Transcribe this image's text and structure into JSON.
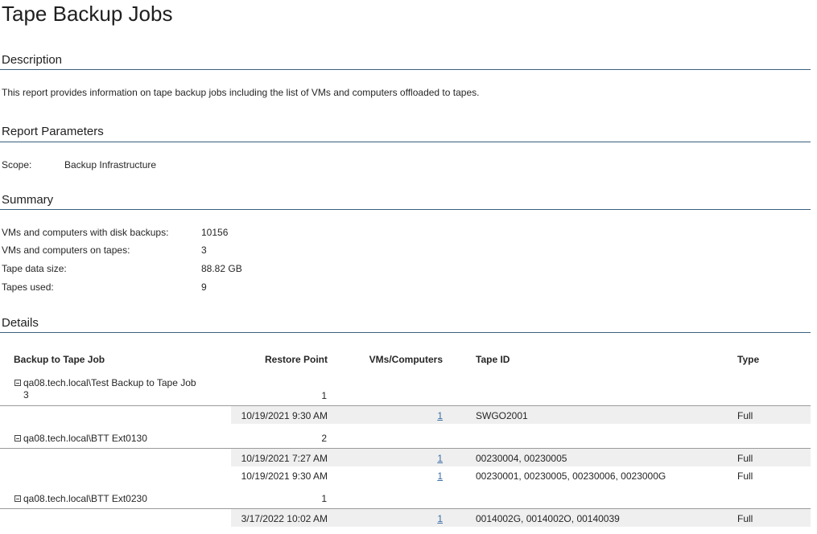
{
  "page_title": "Tape Backup Jobs",
  "sections": {
    "description": {
      "heading": "Description",
      "text": "This report provides information on tape backup jobs including the list of VMs and computers offloaded to tapes."
    },
    "parameters": {
      "heading": "Report Parameters",
      "scope_label": "Scope:",
      "scope_value": "Backup Infrastructure"
    },
    "summary": {
      "heading": "Summary",
      "rows": [
        {
          "label": "VMs and computers with disk backups:",
          "value": "10156"
        },
        {
          "label": "VMs and computers on tapes:",
          "value": "3"
        },
        {
          "label": "Tape data size:",
          "value": "88.82 GB"
        },
        {
          "label": "Tapes used:",
          "value": "9"
        }
      ]
    },
    "details": {
      "heading": "Details",
      "columns": [
        "Backup to Tape Job",
        "Restore Point",
        "VMs/Computers",
        "Tape ID",
        "Type"
      ],
      "groups": [
        {
          "job_line1": "qa08.tech.local\\Test Backup to Tape Job",
          "job_line2": "3",
          "count": "1",
          "rows": [
            {
              "restore_point": "10/19/2021 9:30 AM",
              "vms": "1",
              "tape_id": "SWGO2001",
              "type": "Full"
            }
          ]
        },
        {
          "job_line1": "qa08.tech.local\\BTT Ext0130",
          "count": "2",
          "rows": [
            {
              "restore_point": "10/19/2021 7:27 AM",
              "vms": "1",
              "tape_id": "00230004, 00230005",
              "type": "Full"
            },
            {
              "restore_point": "10/19/2021 9:30 AM",
              "vms": "1",
              "tape_id": "00230001, 00230005, 00230006, 0023000G",
              "type": "Full"
            }
          ]
        },
        {
          "job_line1": "qa08.tech.local\\BTT Ext0230",
          "count": "1",
          "rows": [
            {
              "restore_point": "3/17/2022 10:02 AM",
              "vms": "1",
              "tape_id": "0014002G, 0014002O, 00140039",
              "type": "Full"
            }
          ]
        }
      ]
    }
  },
  "colors": {
    "rule": "#3a5f7d",
    "row_shade": "#efefef",
    "link": "#3a6ea5"
  }
}
